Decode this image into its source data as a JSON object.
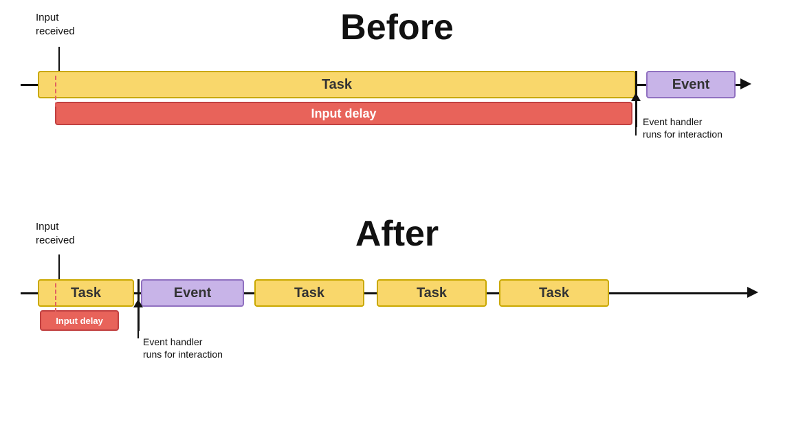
{
  "before": {
    "title": "Before",
    "input_received_label": "Input\nreceived",
    "task_label": "Task",
    "event_label": "Event",
    "input_delay_label": "Input delay",
    "event_handler_label": "Event handler\nruns for interaction"
  },
  "after": {
    "title": "After",
    "input_received_label": "Input\nreceived",
    "task_label": "Task",
    "event_label": "Event",
    "input_delay_label": "Input delay",
    "event_handler_label": "Event handler\nruns for interaction",
    "task2_label": "Task",
    "task3_label": "Task",
    "task4_label": "Task"
  },
  "colors": {
    "task_bg": "#f9d76b",
    "task_border": "#c9a800",
    "event_bg": "#c8b4e8",
    "event_border": "#9070c0",
    "delay_bg": "#e8635a",
    "delay_border": "#c04040",
    "timeline": "#111111",
    "text": "#111111"
  }
}
